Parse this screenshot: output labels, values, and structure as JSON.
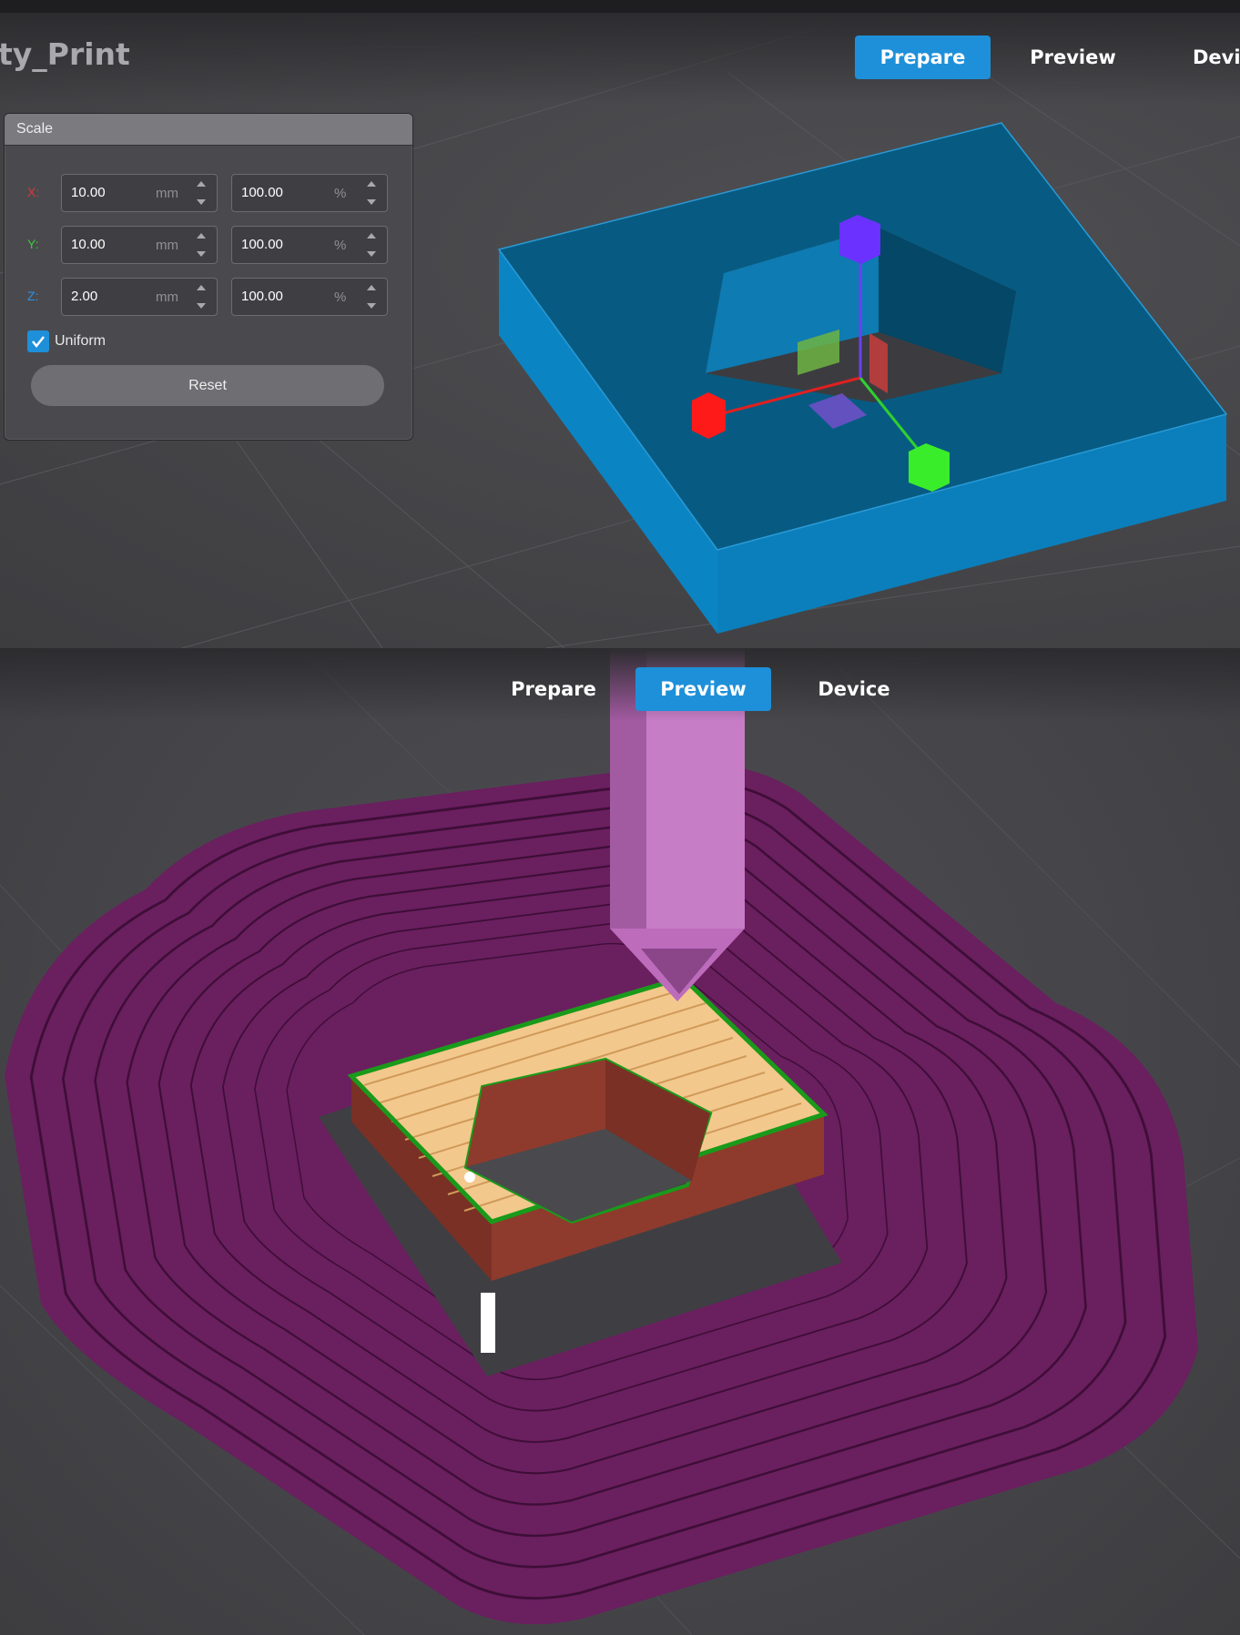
{
  "top_view": {
    "app_title": "ty_Print",
    "tabs": [
      "Prepare",
      "Preview",
      "Devic"
    ],
    "active_tab": "Prepare",
    "scale_dialog": {
      "title": "Scale",
      "rows": [
        {
          "axis": "X:",
          "axis_color": "#d83a3a",
          "size_value": "10.00",
          "size_unit": "mm",
          "percent_value": "100.00",
          "percent_unit": "%"
        },
        {
          "axis": "Y:",
          "axis_color": "#3ec43e",
          "size_value": "10.00",
          "size_unit": "mm",
          "percent_value": "100.00",
          "percent_unit": "%"
        },
        {
          "axis": "Z:",
          "axis_color": "#2e8fe0",
          "size_value": "2.00",
          "size_unit": "mm",
          "percent_value": "100.00",
          "percent_unit": "%"
        }
      ],
      "uniform_label": "Uniform",
      "uniform_checked": true,
      "reset_label": "Reset"
    },
    "model_color": "#0b82bf"
  },
  "bottom_view": {
    "tabs": [
      "Prepare",
      "Preview",
      "Device"
    ],
    "active_tab": "Preview",
    "colors": {
      "skirt": "#6d2060",
      "walls": "#8c3a2c",
      "infill": "#f6c98e",
      "perimeter_green": "#1a9a1a",
      "nozzle": "#c77cc6"
    }
  },
  "accent_color": "#1e90d9"
}
